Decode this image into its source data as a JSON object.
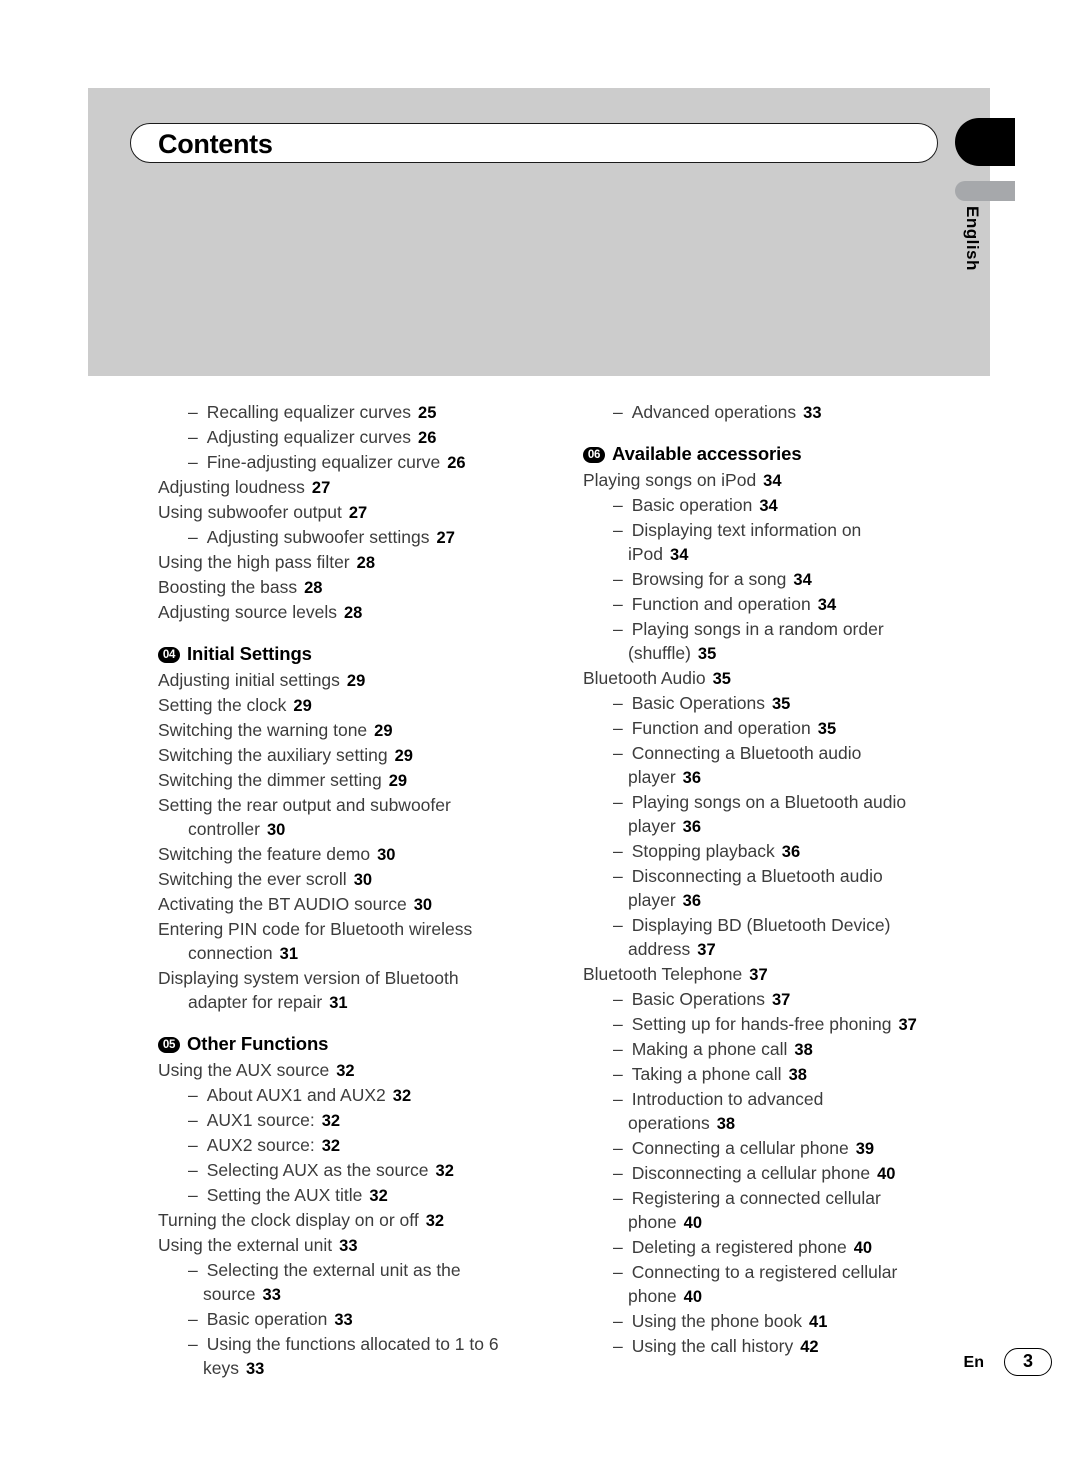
{
  "header": {
    "title": "Contents",
    "language_tab": "English"
  },
  "footer": {
    "language_code": "En",
    "page_number": "3"
  },
  "colors": {
    "header_band": "#cccccc",
    "tab_black": "#000000",
    "tab_grey": "#a6a8ab",
    "entry_text": "#3c3c3c",
    "page_number": "#000000"
  },
  "left_column": [
    {
      "level": 2,
      "dash": "–",
      "text": "Recalling equalizer curves",
      "page": "25"
    },
    {
      "level": 2,
      "dash": "–",
      "text": "Adjusting equalizer curves",
      "page": "26"
    },
    {
      "level": 2,
      "dash": "–",
      "text": "Fine-adjusting equalizer curve",
      "page": "26"
    },
    {
      "level": 1,
      "text": "Adjusting loudness",
      "page": "27"
    },
    {
      "level": 1,
      "text": "Using subwoofer output",
      "page": "27"
    },
    {
      "level": 2,
      "dash": "–",
      "text": "Adjusting subwoofer settings",
      "page": "27"
    },
    {
      "level": 1,
      "text": "Using the high pass filter",
      "page": "28"
    },
    {
      "level": 1,
      "text": "Boosting the bass",
      "page": "28"
    },
    {
      "level": 1,
      "text": "Adjusting source levels",
      "page": "28"
    },
    {
      "level": 0,
      "badge": "04",
      "text": "Initial Settings"
    },
    {
      "level": 1,
      "text": "Adjusting initial settings",
      "page": "29"
    },
    {
      "level": 1,
      "text": "Setting the clock",
      "page": "29"
    },
    {
      "level": 1,
      "text": "Switching the warning tone",
      "page": "29"
    },
    {
      "level": 1,
      "text": "Switching the auxiliary setting",
      "page": "29"
    },
    {
      "level": 1,
      "text": "Switching the dimmer setting",
      "page": "29"
    },
    {
      "level": 1,
      "text": "Setting the rear output and subwoofer",
      "cont": "controller",
      "page": "30"
    },
    {
      "level": 1,
      "text": "Switching the feature demo",
      "page": "30"
    },
    {
      "level": 1,
      "text": "Switching the ever scroll",
      "page": "30"
    },
    {
      "level": 1,
      "text": "Activating the BT AUDIO source",
      "page": "30"
    },
    {
      "level": 1,
      "text": "Entering PIN code for Bluetooth wireless",
      "cont": "connection",
      "page": "31"
    },
    {
      "level": 1,
      "text": "Displaying system version of Bluetooth",
      "cont": "adapter for repair",
      "page": "31"
    },
    {
      "level": 0,
      "badge": "05",
      "text": "Other Functions"
    },
    {
      "level": 1,
      "text": "Using the AUX source",
      "page": "32"
    },
    {
      "level": 2,
      "dash": "–",
      "text": "About AUX1 and AUX2",
      "page": "32"
    },
    {
      "level": 2,
      "dash": "–",
      "text": "AUX1 source:",
      "page": "32"
    },
    {
      "level": 2,
      "dash": "–",
      "text": "AUX2 source:",
      "page": "32"
    },
    {
      "level": 2,
      "dash": "–",
      "text": "Selecting AUX as the source",
      "page": "32"
    },
    {
      "level": 2,
      "dash": "–",
      "text": "Setting the AUX title",
      "page": "32"
    },
    {
      "level": 1,
      "text": "Turning the clock display on or off",
      "page": "32"
    },
    {
      "level": 1,
      "text": "Using the external unit",
      "page": "33"
    },
    {
      "level": 2,
      "dash": "–",
      "text": "Selecting the external unit as the",
      "cont": "source",
      "page": "33"
    },
    {
      "level": 2,
      "dash": "–",
      "text": "Basic operation",
      "page": "33"
    },
    {
      "level": 2,
      "dash": "–",
      "text": "Using the functions allocated to 1 to 6",
      "cont": "keys",
      "page": "33"
    }
  ],
  "right_column": [
    {
      "level": 2,
      "dash": "–",
      "text": "Advanced operations",
      "page": "33"
    },
    {
      "level": 0,
      "badge": "06",
      "text": "Available accessories"
    },
    {
      "level": 1,
      "text": "Playing songs on iPod",
      "page": "34"
    },
    {
      "level": 2,
      "dash": "–",
      "text": "Basic operation",
      "page": "34"
    },
    {
      "level": 2,
      "dash": "–",
      "text": "Displaying text information on",
      "cont": "iPod",
      "page": "34"
    },
    {
      "level": 2,
      "dash": "–",
      "text": "Browsing for a song",
      "page": "34"
    },
    {
      "level": 2,
      "dash": "–",
      "text": "Function and operation",
      "page": "34"
    },
    {
      "level": 2,
      "dash": "–",
      "text": "Playing songs in a random order",
      "cont": "(shuffle)",
      "page": "35"
    },
    {
      "level": 1,
      "text": "Bluetooth Audio",
      "page": "35"
    },
    {
      "level": 2,
      "dash": "–",
      "text": "Basic Operations",
      "page": "35"
    },
    {
      "level": 2,
      "dash": "–",
      "text": "Function and operation",
      "page": "35"
    },
    {
      "level": 2,
      "dash": "–",
      "text": "Connecting a Bluetooth audio",
      "cont": "player",
      "page": "36"
    },
    {
      "level": 2,
      "dash": "–",
      "text": "Playing songs on a Bluetooth audio",
      "cont": "player",
      "page": "36"
    },
    {
      "level": 2,
      "dash": "–",
      "text": "Stopping playback",
      "page": "36"
    },
    {
      "level": 2,
      "dash": "–",
      "text": "Disconnecting a Bluetooth audio",
      "cont": "player",
      "page": "36"
    },
    {
      "level": 2,
      "dash": "–",
      "text": "Displaying BD (Bluetooth Device)",
      "cont": "address",
      "page": "37"
    },
    {
      "level": 1,
      "text": "Bluetooth Telephone",
      "page": "37"
    },
    {
      "level": 2,
      "dash": "–",
      "text": "Basic Operations",
      "page": "37"
    },
    {
      "level": 2,
      "dash": "–",
      "text": "Setting up for hands-free phoning",
      "page": "37"
    },
    {
      "level": 2,
      "dash": "–",
      "text": "Making a phone call",
      "page": "38"
    },
    {
      "level": 2,
      "dash": "–",
      "text": "Taking a phone call",
      "page": "38"
    },
    {
      "level": 2,
      "dash": "–",
      "text": "Introduction to advanced",
      "cont": "operations",
      "page": "38"
    },
    {
      "level": 2,
      "dash": "–",
      "text": "Connecting a cellular phone",
      "page": "39"
    },
    {
      "level": 2,
      "dash": "–",
      "text": "Disconnecting a cellular phone",
      "page": "40"
    },
    {
      "level": 2,
      "dash": "–",
      "text": "Registering a connected cellular",
      "cont": "phone",
      "page": "40"
    },
    {
      "level": 2,
      "dash": "–",
      "text": "Deleting a registered phone",
      "page": "40"
    },
    {
      "level": 2,
      "dash": "–",
      "text": "Connecting to a registered cellular",
      "cont": "phone",
      "page": "40"
    },
    {
      "level": 2,
      "dash": "–",
      "text": "Using the phone book",
      "page": "41"
    },
    {
      "level": 2,
      "dash": "–",
      "text": "Using the call history",
      "page": "42"
    }
  ]
}
